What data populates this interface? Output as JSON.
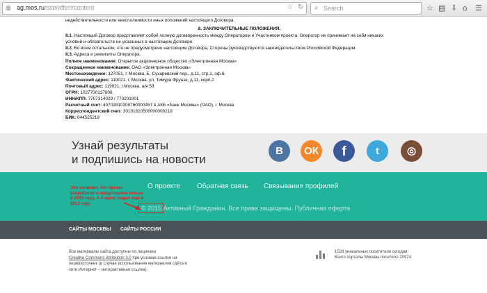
{
  "browser": {
    "url_domain": "ag.mos.ru",
    "url_path": "/site/offer#content",
    "search_placeholder": "Search",
    "star_icon": "☆",
    "reload_icon": "↻",
    "globe_icon": "◍",
    "search_glass": "⌕"
  },
  "document": {
    "line0": "недействительности или неисполнимости иных положений настоящего Договора.",
    "section_title": "8. ЗАКЛЮЧИТЕЛЬНЫЕ ПОЛОЖЕНИЯ.",
    "p81_num": "8.1.",
    "p81_a": " Настоящий Договор представляет собой полную договоренность между Оператором и Участником проекта. Оператор не принимает на себя никаких",
    "p81_b": "условий и обязательств не указанных в настоящем Договоре.",
    "p82_num": "8.2.",
    "p82": " Во всем остальном, что не предусмотрено настоящим Договора, Стороны руководствуются законодательством Российской Федерации.",
    "p83_num": "8.3.",
    "p83": " Адреса и реквизиты Оператора.",
    "full_name_label": "Полное наименование:",
    "full_name": " Открытое акционерное общество «Электронная Москва»",
    "short_name_label": "Сокращенное наименование:",
    "short_name": " ОАО «Электронная Москва»",
    "location_label": "Местонахождение:",
    "location": " 127051, г. Москва, Б. Сухаревский пер., д.11, стр.1, оф.6",
    "actual_label": "Фактический адрес:",
    "actual": " 119021, г. Москва, ул. Тимура Фрунзе, д.11, корп.2",
    "postal_label": "Почтовый адрес:",
    "postal": " 119021, г.Москва, а/я 50",
    "ogrn_label": "ОГРН:",
    "ogrn": " 1027700137806",
    "inn_label": "ИНН/КПП:",
    "inn": " 7707314029 / 770201001",
    "account_label": "Расчетный счет:",
    "account": " 40702810300760000457 в АКБ «Банк Москвы» (ОАО), г. Москва",
    "corr_label": "Корреспондентский счет:",
    "corr": " 30101810500000000219",
    "bik_label": "БИК:",
    "bik": " 044525219"
  },
  "subscribe": {
    "title_line1": "Узнай результаты",
    "title_line2": "и подпишись на новости",
    "vk_glyph": "B",
    "ok_glyph": "ОК",
    "fb_glyph": "f",
    "tw_glyph": "t",
    "ig_glyph": "◎"
  },
  "footer": {
    "links": [
      "О проекте",
      "Обратная связь",
      "Связывание профилей"
    ],
    "copyright_year": "© 2015",
    "copyright_text": " Активный Гражданин. Все права защищены. Публичная оферта",
    "annotation": "Это означает, что проект разработан и представлен только в 2015 году. А я идею подал ещё в 2012 году"
  },
  "darkbar": {
    "link1": "САЙТЫ МОСКВЫ",
    "link2": "САЙТЫ РОССИИ"
  },
  "bottom": {
    "license_1": "Все материалы сайта доступны по лицензии",
    "license_link": "Creative Commons Attribution 3.0",
    "license_2": " при условии ссылки на первоисточник (в случае использования материалов сайта в сети Интернет – интерактивная ссылка).",
    "stats_line1": "1528 уникальных посетителя сегодня.",
    "stats_line2": "Всего порталы Москвы посетило 20974."
  },
  "colors": {
    "teal": "#20b49c",
    "dark": "#4a5258",
    "annotation_red": "#d9221f"
  }
}
